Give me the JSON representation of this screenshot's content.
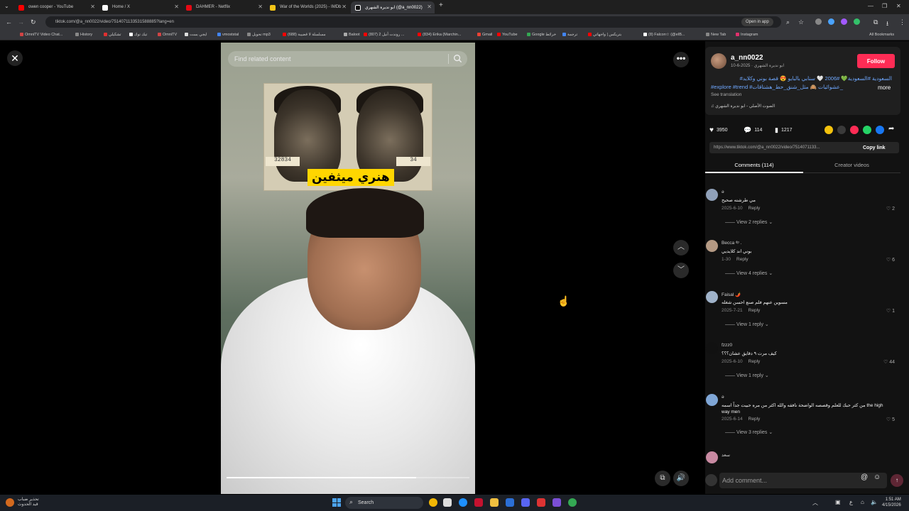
{
  "browser": {
    "tabs": [
      {
        "label": "owen cooper - YouTube",
        "color": "#ff0000"
      },
      {
        "label": "Home / X",
        "color": "#ffffff"
      },
      {
        "label": "DAHMER - Netflix",
        "color": "#e50914"
      },
      {
        "label": "War of the Worlds (2025) - IMDb",
        "color": "#f5c518"
      },
      {
        "label": "ابو نديرة الشهري (@a_nn0022)",
        "color": "#ffffff"
      }
    ],
    "url": "tiktok.com/@a_nn0022/video/7514071133531588885?lang=en",
    "open_in_app": "Open in app",
    "bookmarks": [
      {
        "label": "OmniTV Video Chat...",
        "color": "#d04444"
      },
      {
        "label": "History",
        "color": "#888888"
      },
      {
        "label": "تشكيلي",
        "color": "#e03030"
      },
      {
        "label": "تيك توك",
        "color": "#ffffff"
      },
      {
        "label": "OmniTV",
        "color": "#d04444"
      },
      {
        "label": "ايجي بست",
        "color": "#dddddd"
      },
      {
        "label": "vmoststal",
        "color": "#4285f4"
      },
      {
        "label": "تحويل mp3",
        "color": "#888888"
      },
      {
        "label": "(688) مسلسلة لا قضيبة",
        "color": "#ff0000"
      },
      {
        "label": "Baloot",
        "color": "#aaaaaa"
      },
      {
        "label": "(807) روندت أنيل 2 ...",
        "color": "#ff0000"
      },
      {
        "label": "(834) Erika (Marchin...",
        "color": "#ff0000"
      },
      {
        "label": "Gmail",
        "color": "#ea4335"
      },
      {
        "label": "YouTube",
        "color": "#ff0000"
      },
      {
        "label": "Google خرائط",
        "color": "#34a853"
      },
      {
        "label": "ترجمة",
        "color": "#4285f4"
      },
      {
        "label": "بتريكس | واجهاتي",
        "color": "#ff0000"
      },
      {
        "label": "(8) Falcon☆ (@eIB...",
        "color": "#ffffff"
      },
      {
        "label": "New Tab",
        "color": "#888888"
      },
      {
        "label": "Instagram",
        "color": "#e1306c"
      }
    ],
    "all_bookmarks": "All Bookmarks"
  },
  "video": {
    "search_placeholder": "Find related content",
    "caption": "هنري ميثفين",
    "plate_left": "32834",
    "plate_right": "34",
    "progress_fraction": 0.78
  },
  "panel": {
    "author": {
      "username": "a_nn0022",
      "nickname": "ابو نديرة الشهري",
      "date": "2025-6-10",
      "follow_label": "Follow"
    },
    "description_line1": "#السعودية #السعودية💚 #2006 🤍 سنابي بالبايو 😍 قصة بوني وكلايد",
    "description_line2": "#explore #trend #عشوائيات 🙈 مثل_شنق_حط_هشتاقات_",
    "more_label": "more",
    "see_translation": "See translation",
    "sound": "الصوت الأصلي - ابو نديرة الشهري",
    "likes": "3950",
    "comments_count": "114",
    "saves": "1217",
    "share_colors": [
      "#f4c20d",
      "#3a3a3a",
      "#fe2c55",
      "#25d366",
      "#1877f2"
    ],
    "link": "https://www.tiktok.com/@a_nn0022/video/7514071133...",
    "copy_link": "Copy link",
    "tab_comments": "Comments (114)",
    "tab_creator": "Creator videos",
    "comments": [
      {
        "user": "ǝ",
        "text": "مي طرشته صحيح",
        "date": "2025-6-10",
        "reply": "Reply",
        "likes": "2",
        "view_replies": "View 2 replies"
      },
      {
        "user": "Becca ᵈᵖ .",
        "text": "بوني اند كلايديي",
        "date": "1-30",
        "reply": "Reply",
        "likes": "6",
        "view_replies": "View 4 replies"
      },
      {
        "user": "Faisal 🌶️",
        "text": "مسوين عنهم فلم صنع احسن شغله",
        "date": "2025-7-21",
        "reply": "Reply",
        "likes": "1",
        "view_replies": "View 1 reply"
      },
      {
        "user": "fzzz0",
        "text": "كيف مرت ٩ دقايق عشان؟؟؟",
        "date": "2025-6-10",
        "reply": "Reply",
        "likes": "44",
        "view_replies": "View 1 reply"
      },
      {
        "user": "ǝ",
        "text": "من كثر حبك للعلم وقصصه الواضحة نافقه والله اكثر من مره حبيت جداً اسمه the high way men",
        "date": "2025-6-14",
        "reply": "Reply",
        "likes": "5",
        "view_replies": "View 3 replies"
      },
      {
        "user": "سعد",
        "text": "",
        "date": "",
        "reply": "",
        "likes": "",
        "view_replies": ""
      }
    ],
    "add_comment_placeholder": "Add comment..."
  },
  "taskbar": {
    "weather_line1": "تحذير ضباب",
    "weather_line2": "قيد الحدوث",
    "search_label": "Search",
    "time": "1:51 AM",
    "date": "4/15/2026",
    "lang": "ع"
  }
}
